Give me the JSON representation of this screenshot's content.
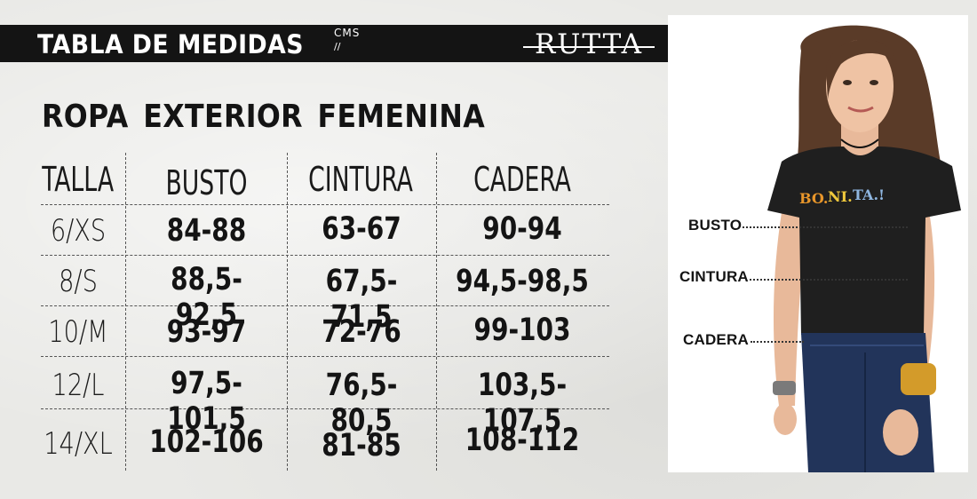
{
  "header": {
    "title": "TABLA DE MEDIDAS",
    "unit": "CMS",
    "unit_mark": "//",
    "brand": "RUTTA"
  },
  "subtitle": "ROPA  EXTERIOR FEMENINA",
  "table": {
    "columns": [
      "TALLA",
      "BUSTO",
      "CINTURA",
      "CADERA"
    ],
    "rows": [
      {
        "size": "6/XS",
        "busto": "84-88",
        "cintura": "63-67",
        "cadera": "90-94"
      },
      {
        "size": "8/S",
        "busto": "88,5-92,5",
        "cintura": "67,5-71,5",
        "cadera": "94,5-98,5"
      },
      {
        "size": "10/M",
        "busto": "93-97",
        "cintura": "72-76",
        "cadera": "99-103"
      },
      {
        "size": "12/L",
        "busto": "97,5-101,5",
        "cintura": "76,5-80,5",
        "cadera": "103,5-107,5"
      },
      {
        "size": "14/XL",
        "busto": "102-106",
        "cintura": "81-85",
        "cadera": "108-112"
      }
    ]
  },
  "figure": {
    "shirt_text": [
      "BO.",
      "NI.",
      "TA.!"
    ],
    "callouts": [
      "BUSTO",
      "CINTURA",
      "CADERA"
    ]
  },
  "colors": {
    "band": "#141414",
    "background": "#e9e9e6",
    "shirt": "#1f1f1f",
    "jeans": "#22345a",
    "hair": "#5a3b28",
    "skin": "#e8b99a",
    "shirt_text_1": "#e8962a",
    "shirt_text_2": "#f0c93c",
    "shirt_text_3": "#8fb6e0"
  }
}
